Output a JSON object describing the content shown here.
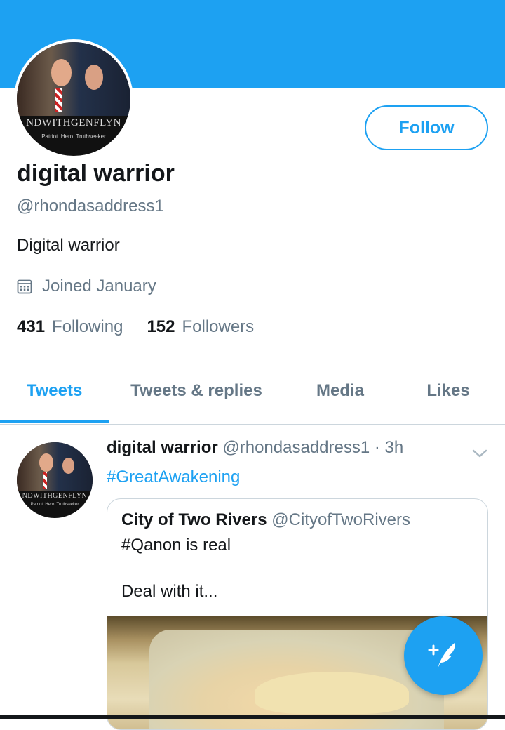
{
  "profile": {
    "display_name": "digital warrior",
    "handle": "@rhondasaddress1",
    "bio": "Digital warrior",
    "joined": "Joined January",
    "following_count": "431",
    "following_label": "Following",
    "followers_count": "152",
    "followers_label": "Followers",
    "follow_button": "Follow",
    "avatar_text_main": "NDWITHGENFLYN",
    "avatar_text_sub": "Patriot. Hero. Truthseeker"
  },
  "tabs": [
    {
      "label": "Tweets",
      "active": true
    },
    {
      "label": "Tweets & replies",
      "active": false
    },
    {
      "label": "Media",
      "active": false
    },
    {
      "label": "Likes",
      "active": false
    }
  ],
  "tweet": {
    "author_name": "digital warrior",
    "author_handle": "@rhondasaddress1",
    "time": "· 3h",
    "text": "#GreatAwakening",
    "avatar_text_main": "NDWITHGENFLYN",
    "avatar_text_sub": "Patriot. Hero. Truthseeker",
    "quote": {
      "author_name": "City of Two Rivers",
      "author_handle": "@CityofTwoRivers",
      "line1": "#Qanon is real",
      "line2": "Deal with it..."
    }
  },
  "icons": {
    "calendar": "calendar-icon",
    "chevron": "chevron-down-icon",
    "compose": "compose-tweet-icon"
  },
  "colors": {
    "accent": "#1da1f2",
    "text_primary": "#14171a",
    "text_secondary": "#657786",
    "border": "#ccd6dd"
  }
}
